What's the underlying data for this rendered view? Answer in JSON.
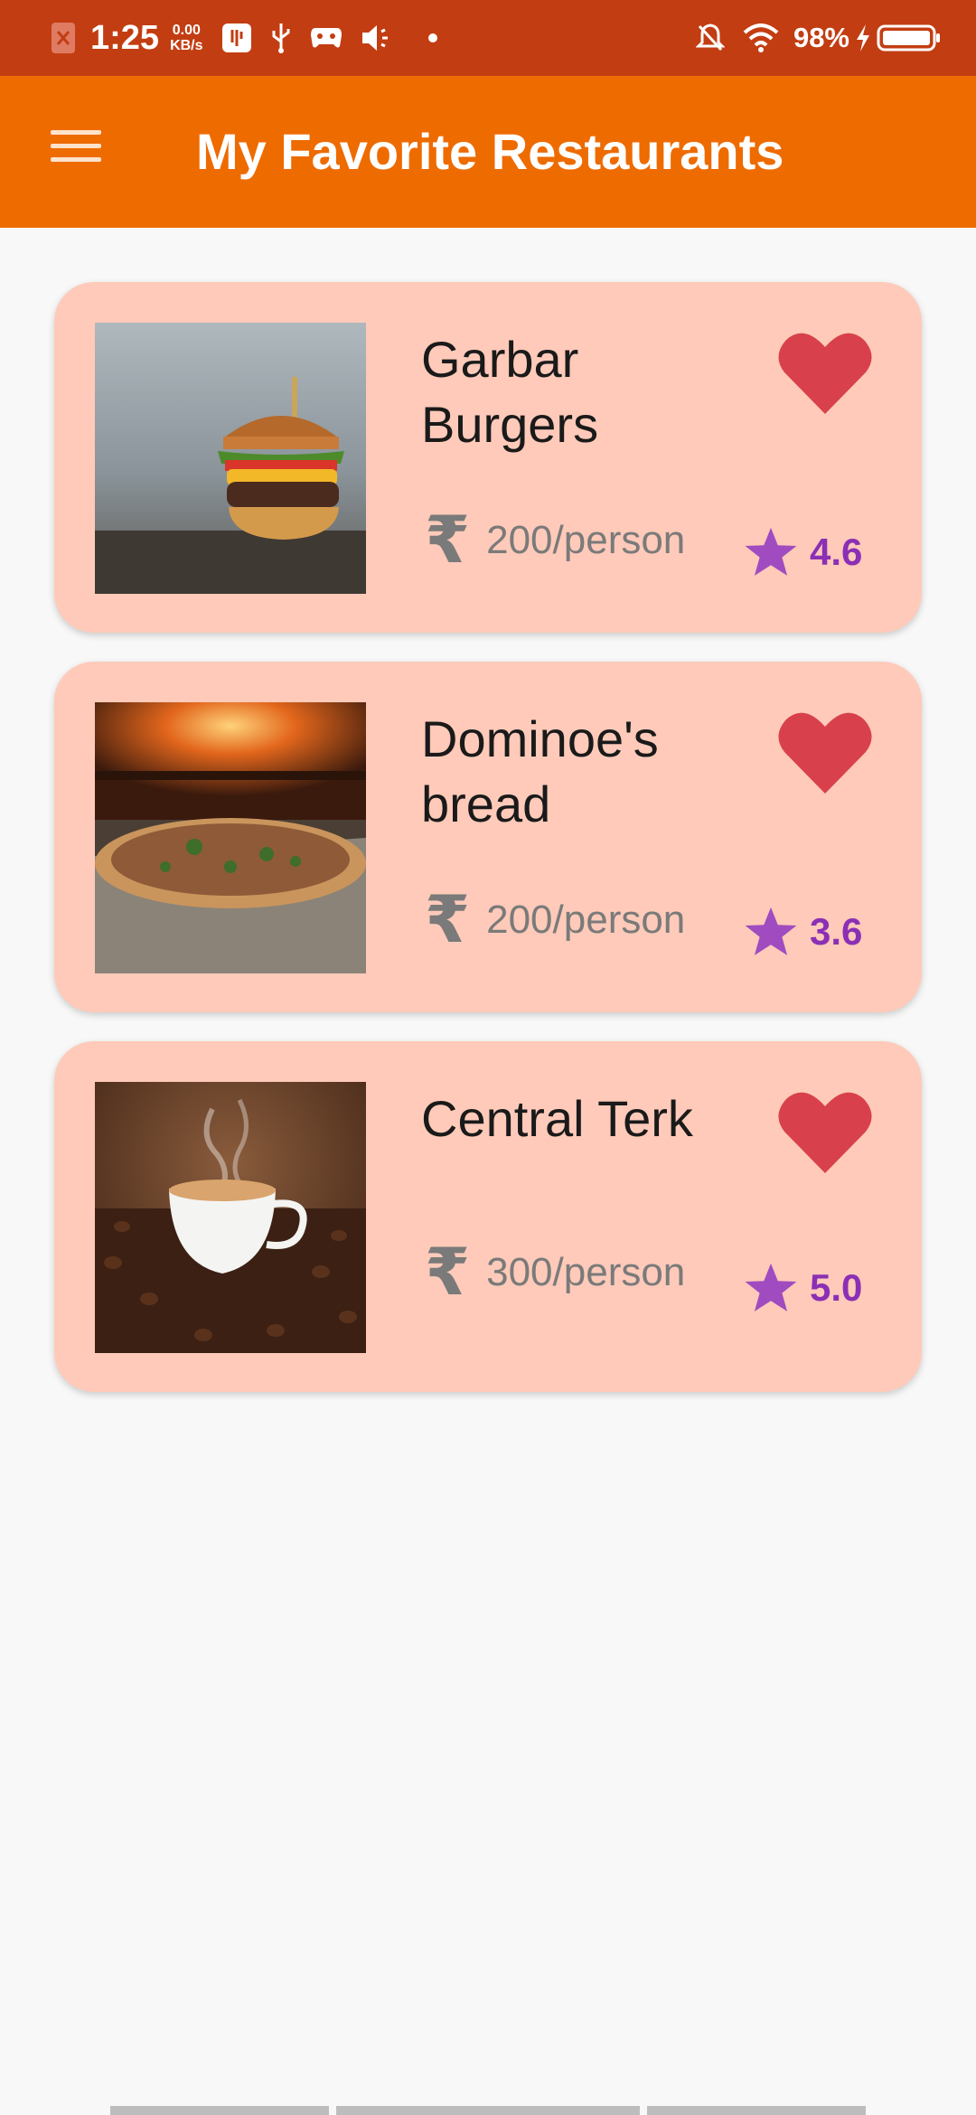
{
  "status_bar": {
    "time": "1:25",
    "speed_value": "0.00",
    "speed_unit": "KB/s",
    "battery": "98%",
    "icons": [
      "notification-x-icon",
      "usb-settings-icon",
      "usb-icon",
      "gamepad-icon",
      "volume-icon",
      "dot-icon",
      "silent-bell-icon",
      "wifi-icon",
      "charging-icon",
      "battery-icon"
    ]
  },
  "app_bar": {
    "title": "My Favorite Restaurants",
    "menu_icon": "hamburger-menu-icon",
    "color": "#ee6b00"
  },
  "restaurants": [
    {
      "name": "Garbar Burgers",
      "price": "200/person",
      "rating": "4.6",
      "image": "burger-photo",
      "favorite": true
    },
    {
      "name": "Dominoe's bread",
      "price": "200/person",
      "rating": "3.6",
      "image": "pizza-photo",
      "favorite": true
    },
    {
      "name": "Central Terk",
      "price": "300/person",
      "rating": "5.0",
      "image": "coffee-photo",
      "favorite": true
    }
  ],
  "currency_symbol": "₹",
  "colors": {
    "status_bar": "#c33d12",
    "card_bg": "#ffcab9",
    "heart": "#d8414b",
    "star": "#a04cc0",
    "rating_text": "#8b2fb5"
  }
}
